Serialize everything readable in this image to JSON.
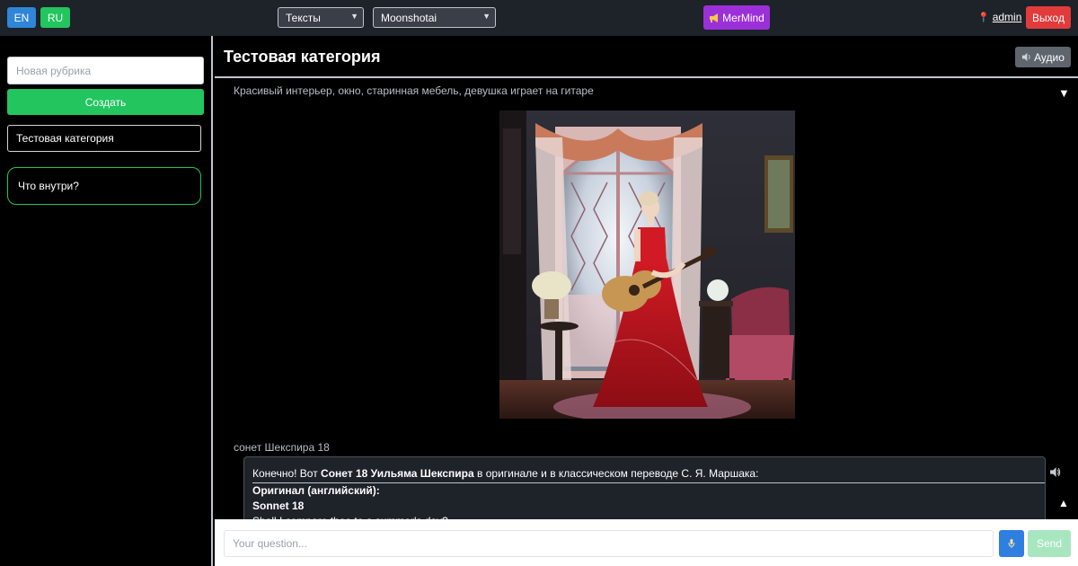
{
  "topbar": {
    "lang_en": "EN",
    "lang_ru": "RU",
    "content_type": "Тексты",
    "model": "Moonshotai",
    "mermind_label": "MerMind",
    "user_name": "admin",
    "logout_label": "Выход"
  },
  "sidebar": {
    "new_rubric_placeholder": "Новая рубрика",
    "create_label": "Создать",
    "categories": [
      "Тестовая категория"
    ],
    "what_inside": "Что внутри?"
  },
  "main": {
    "title": "Тестовая категория",
    "audio_label": "Аудио",
    "prompt_1": "Красивый интерьер, окно, старинная мебель, девушка играет на гитаре",
    "prompt_2": "сонет Шекспира 18",
    "answer": {
      "intro_pre": "Конечно! Вот ",
      "intro_bold": "Сонет 18 Уильяма Шекспира",
      "intro_post": " в оригинале и в классическом переводе С. Я. Маршака:",
      "original_heading": "Оригинал (английский):",
      "sonnet_title": "Sonnet 18",
      "first_line": "Shall I compare thee to a summer's day?"
    }
  },
  "inputbar": {
    "placeholder": "Your question...",
    "send_label": "Send"
  },
  "colors": {
    "topbar_bg": "#1e2229",
    "accent_green": "#22c55e",
    "accent_blue": "#2f86d8",
    "mermind_purple": "#9b30d9",
    "logout_red": "#e23b3b"
  },
  "icons": {
    "mermind": "megaphone-icon",
    "user": "pin-icon",
    "audio": "speaker-icon",
    "mic": "microphone-icon",
    "collapse": "triangle-down-icon",
    "expand": "triangle-up-icon"
  }
}
